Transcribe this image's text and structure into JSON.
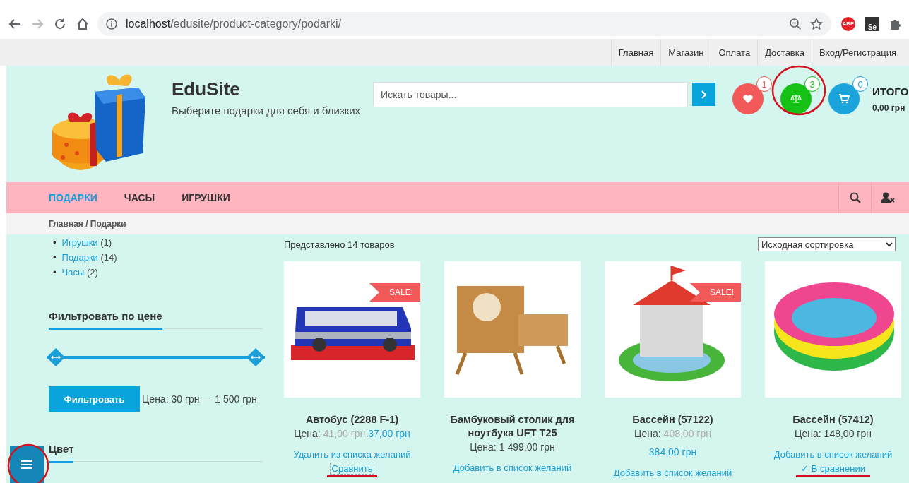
{
  "browser": {
    "url_host": "localhost",
    "url_path": "/edusite/product-category/podarki/",
    "extensions": [
      {
        "kind": "abp",
        "label": "ABP"
      },
      {
        "kind": "se",
        "label": "Se"
      },
      {
        "kind": "puzzle"
      }
    ]
  },
  "top_menu": [
    {
      "label": "Главная"
    },
    {
      "label": "Магазин"
    },
    {
      "label": "Оплата"
    },
    {
      "label": "Доставка"
    },
    {
      "label": "Вход/Регистрация"
    }
  ],
  "header": {
    "site_title": "EduSite",
    "tagline": "Выберите подарки для себя и близких",
    "search": {
      "placeholder": "Искать товары..."
    },
    "counters": [
      {
        "kind": "wishlist",
        "count": "1",
        "color": "#f25a5a",
        "highlighted": false
      },
      {
        "kind": "compare",
        "count": "3",
        "color": "#16c116",
        "highlighted": true
      },
      {
        "kind": "cart",
        "count": "0",
        "color": "#1ba3dc",
        "highlighted": false
      }
    ],
    "cart_total": {
      "label": "ИТОГО",
      "amount": "0,00 грн"
    }
  },
  "nav": [
    {
      "label": "ПОДАРКИ",
      "selected": true
    },
    {
      "label": "ЧАСЫ",
      "selected": false
    },
    {
      "label": "ИГРУШКИ",
      "selected": false
    }
  ],
  "breadcrumb": "Главная / Подарки",
  "sidebar": {
    "categories": [
      {
        "bullet": "•",
        "name": "Игрушки",
        "count": "(1)"
      },
      {
        "bullet": "•",
        "name": "Подарки",
        "count": "(14)"
      },
      {
        "bullet": "•",
        "name": "Часы",
        "count": "(2)"
      }
    ],
    "price_filter": {
      "title": "Фильтровать по цене",
      "low": {
        "level": 0
      },
      "high": {
        "level": 1
      },
      "button": "Фильтровать",
      "range": "Цена: 30 грн — 1 500 грн"
    },
    "color_title": "Цвет",
    "menu_button": {
      "highlighted": true
    }
  },
  "result_count": "Представлено 14 товаров",
  "sort": {
    "value": "Исходная сортировка"
  },
  "products": [
    {
      "kind": "bus",
      "sale": true,
      "sale_label": "SALE!",
      "name": "Автобус (2288 F-1)",
      "price_label": "Цена:",
      "old_price": "41,00 грн",
      "price": "37,00 грн",
      "price_wrap": false,
      "wishlist": "Удалить из списка желаний",
      "compare": {
        "label": "Сравнить",
        "kind": "add",
        "highlighted": true
      }
    },
    {
      "kind": "table",
      "sale": false,
      "name": "Бамбуковый столик для ноутбука UFT T25",
      "price_label": "Цена:",
      "price": "1 499,00 грн",
      "price_wrap": false,
      "wishlist": "Добавить в список желаний"
    },
    {
      "kind": "castle-pool",
      "sale": true,
      "sale_label": "SALE!",
      "name": "Бассейн (57122)",
      "price_label": "Цена:",
      "old_price": "408,00 грн",
      "price": "384,00 грн",
      "price_wrap": true,
      "wishlist": "Добавить в список желаний"
    },
    {
      "kind": "pool",
      "sale": false,
      "name": "Бассейн (57412)",
      "price_label": "Цена:",
      "price": "148,00 грн",
      "price_wrap": false,
      "wishlist": "Добавить в список желаний",
      "compare": {
        "label": "✓ В сравнении",
        "kind": "added",
        "highlighted": true
      }
    }
  ]
}
